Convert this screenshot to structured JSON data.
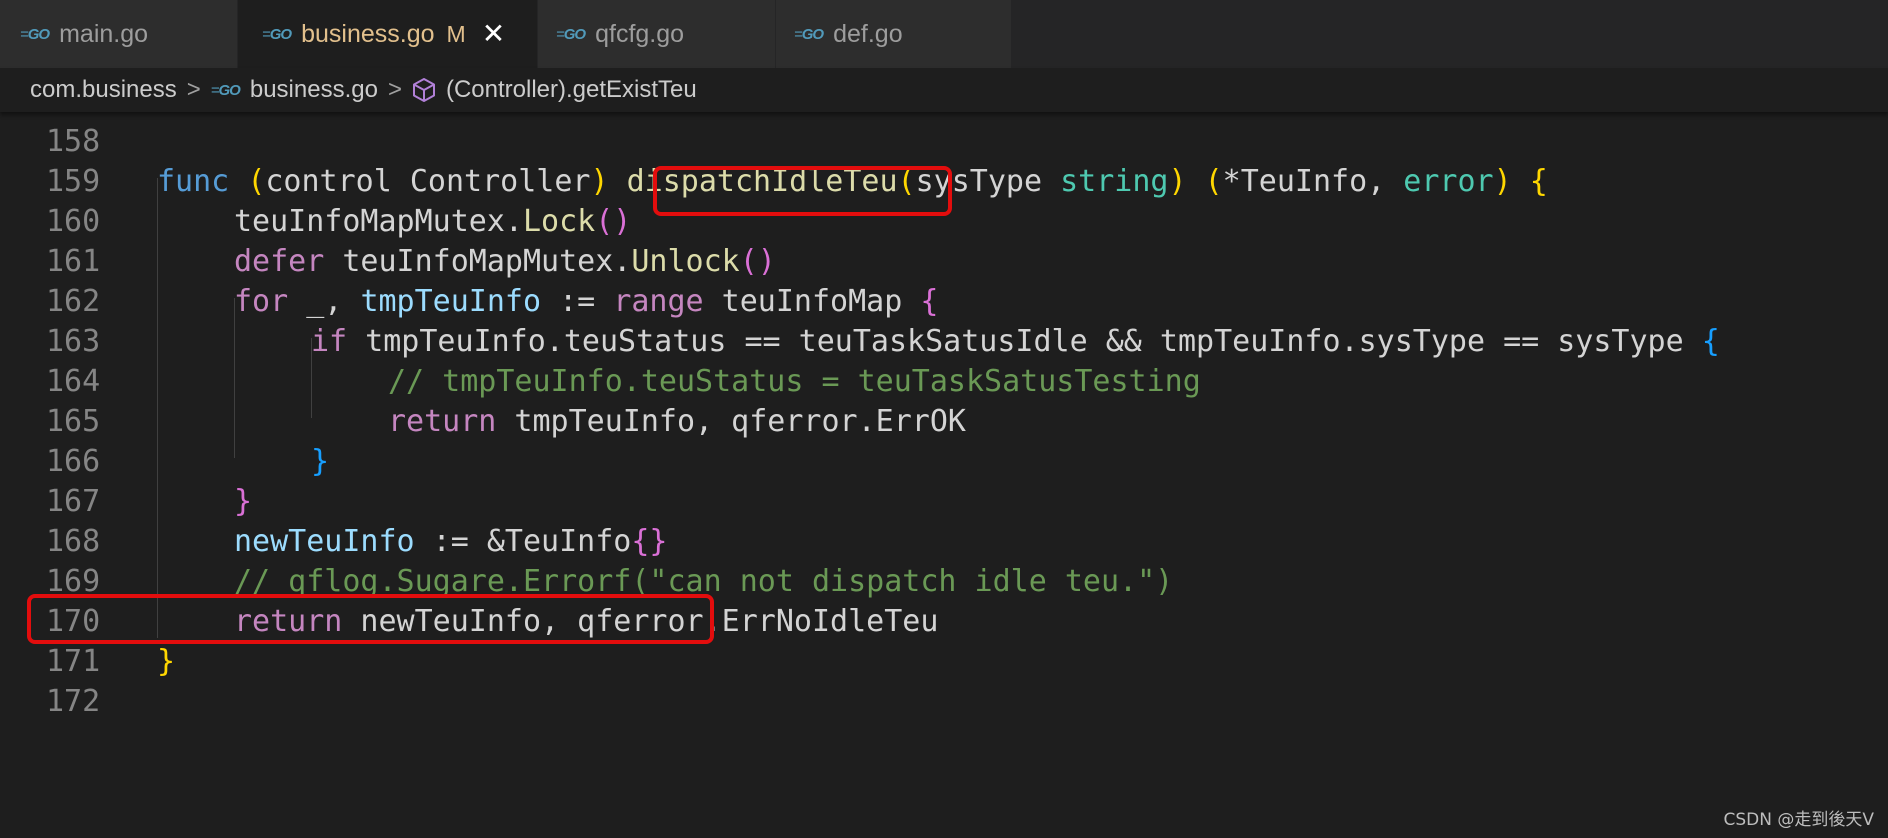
{
  "tabs": [
    {
      "label": "main.go",
      "icon": "go-file-icon"
    },
    {
      "label": "business.go",
      "icon": "go-file-icon",
      "modified": "M",
      "close": "✕"
    },
    {
      "label": "qfcfg.go",
      "icon": "go-file-icon"
    },
    {
      "label": "def.go",
      "icon": "go-file-icon"
    }
  ],
  "breadcrumb": {
    "folder": "com.business",
    "file": "business.go",
    "symbol": "(Controller).getExistTeu",
    "separator": ">"
  },
  "icons": {
    "go_text": "GO",
    "dash": "="
  },
  "code": {
    "line_numbers": [
      "158",
      "159",
      "160",
      "161",
      "162",
      "163",
      "164",
      "165",
      "166",
      "167",
      "168",
      "169",
      "170",
      "171",
      "172"
    ],
    "l159": {
      "func": "func",
      "p1": "(",
      "recv": "control Controller",
      "p2": ")",
      "name": "dispatchIdleTeu",
      "p3": "(",
      "param": "sysType",
      "ptype": "string",
      "p4": ")",
      "p5": "(",
      "ret1": "*TeuInfo, ",
      "ret2": "error",
      "p6": ")",
      "brace": "{"
    },
    "l160": {
      "obj": "teuInfoMapMutex.",
      "fn": "Lock",
      "parens": "()"
    },
    "l161": {
      "kw": "defer",
      "obj": " teuInfoMapMutex.",
      "fn": "Unlock",
      "parens": "()"
    },
    "l162": {
      "kw": "for",
      "a": " _, ",
      "var": "tmpTeuInfo",
      "b": " := ",
      "range": "range",
      "c": " teuInfoMap ",
      "brace": "{"
    },
    "l163": {
      "kw": "if",
      "a": " tmpTeuInfo.teuStatus == teuTaskSatusIdle && tmpTeuInfo.sysType == sysType ",
      "brace": "{"
    },
    "l164": {
      "comment": "// tmpTeuInfo.teuStatus = teuTaskSatusTesting"
    },
    "l165": {
      "kw": "return",
      "a": " tmpTeuInfo, qferror.ErrOK"
    },
    "l166": {
      "brace": "}"
    },
    "l167": {
      "brace": "}"
    },
    "l168": {
      "var": "newTeuInfo",
      "a": " := &TeuInfo",
      "brace": "{}"
    },
    "l169": {
      "comment": "// qflog.Sugare.Errorf(\"can not dispatch idle teu.\")"
    },
    "l170": {
      "kw": "return",
      "a": " newTeuInfo, qferror.ErrNoIdleTeu"
    },
    "l171": {
      "brace": "}"
    }
  },
  "watermark": "CSDN @走到後天V",
  "colors": {
    "background": "#1e1e1e",
    "highlight_box": "#e30d0d",
    "keyword": "#569cd6",
    "control": "#c586c0",
    "function": "#dcdcaa",
    "type": "#4ec9b0",
    "variable": "#9cdcfe",
    "comment": "#6a9955"
  }
}
